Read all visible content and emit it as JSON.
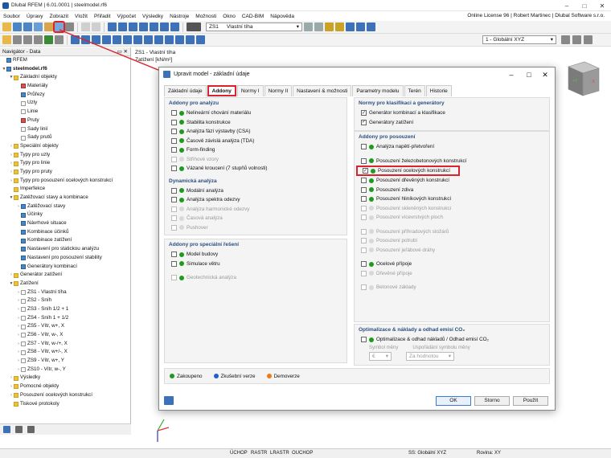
{
  "app": {
    "title": "Dlubal RFEM | 6.01.0001 | steelmodel.rf6"
  },
  "menu": [
    "Soubor",
    "Úpravy",
    "Zobrazit",
    "Vložit",
    "Přiřadit",
    "Výpočet",
    "Výsledky",
    "Nástroje",
    "Možnosti",
    "Okno",
    "CAD-BIM",
    "Nápověda"
  ],
  "license": "Online License 96 | Robert Martinec | Dlubal Software s.r.o.",
  "toolbar": {
    "lc_badge": "G",
    "lc_code": "ZS1",
    "lc_name": "Vlastní tíha",
    "view_combo": "1 - Globální XYZ"
  },
  "navigator": {
    "title": "Navigátor - Data",
    "items": [
      {
        "label": "RFEM",
        "lvl": 0,
        "tw": "",
        "ic": "b"
      },
      {
        "label": "steelmodel.rf6",
        "lvl": 0,
        "tw": "▼",
        "ic": "b",
        "bold": true
      },
      {
        "label": "Základní objekty",
        "lvl": 1,
        "tw": "▼",
        "ic": "y"
      },
      {
        "label": "Materiály",
        "lvl": 2,
        "tw": "",
        "ic": "r"
      },
      {
        "label": "Průřezy",
        "lvl": 2,
        "tw": "",
        "ic": "b"
      },
      {
        "label": "Uzly",
        "lvl": 2,
        "tw": "",
        "ic": ""
      },
      {
        "label": "Linie",
        "lvl": 2,
        "tw": "",
        "ic": ""
      },
      {
        "label": "Pruty",
        "lvl": 2,
        "tw": "",
        "ic": "r"
      },
      {
        "label": "Sady linií",
        "lvl": 2,
        "tw": "",
        "ic": ""
      },
      {
        "label": "Sady prutů",
        "lvl": 2,
        "tw": "",
        "ic": ""
      },
      {
        "label": "Speciální objekty",
        "lvl": 1,
        "tw": "›",
        "ic": "y"
      },
      {
        "label": "Typy pro uzly",
        "lvl": 1,
        "tw": "›",
        "ic": "y"
      },
      {
        "label": "Typy pro linie",
        "lvl": 1,
        "tw": "›",
        "ic": "y"
      },
      {
        "label": "Typy pro pruty",
        "lvl": 1,
        "tw": "›",
        "ic": "y"
      },
      {
        "label": "Typy pro posouzení ocelových konstrukcí",
        "lvl": 1,
        "tw": "›",
        "ic": "y"
      },
      {
        "label": "Imperfekce",
        "lvl": 1,
        "tw": "",
        "ic": "y"
      },
      {
        "label": "Zatěžovací stavy a kombinace",
        "lvl": 1,
        "tw": "▼",
        "ic": "y"
      },
      {
        "label": "Zatěžovací stavy",
        "lvl": 2,
        "tw": "›",
        "ic": "b"
      },
      {
        "label": "Účinky",
        "lvl": 2,
        "tw": "",
        "ic": "b"
      },
      {
        "label": "Návrhové situace",
        "lvl": 2,
        "tw": "",
        "ic": "b"
      },
      {
        "label": "Kombinace účinků",
        "lvl": 2,
        "tw": "",
        "ic": "b"
      },
      {
        "label": "Kombinace zatížení",
        "lvl": 2,
        "tw": "",
        "ic": "b"
      },
      {
        "label": "Nastavení pro statickou analýzu",
        "lvl": 2,
        "tw": "",
        "ic": "b"
      },
      {
        "label": "Nastavení pro posouzení stability",
        "lvl": 2,
        "tw": "",
        "ic": "b"
      },
      {
        "label": "Generátory kombinací",
        "lvl": 2,
        "tw": "",
        "ic": "b"
      },
      {
        "label": "Generátor zatížení",
        "lvl": 1,
        "tw": "›",
        "ic": "y"
      },
      {
        "label": "Zatížení",
        "lvl": 1,
        "tw": "▼",
        "ic": "y"
      },
      {
        "label": "ZS1 - Vlastní tíha",
        "lvl": 2,
        "tw": "›",
        "ic": ""
      },
      {
        "label": "ZS2 - Sníh",
        "lvl": 2,
        "tw": "›",
        "ic": ""
      },
      {
        "label": "ZS3 - Sníh 1/2 + 1",
        "lvl": 2,
        "tw": "›",
        "ic": ""
      },
      {
        "label": "ZS4 - Sníh 1 + 1/2",
        "lvl": 2,
        "tw": "›",
        "ic": ""
      },
      {
        "label": "ZS5 - Vítr, w+, X",
        "lvl": 2,
        "tw": "›",
        "ic": ""
      },
      {
        "label": "ZS6 - Vítr, w-, X",
        "lvl": 2,
        "tw": "›",
        "ic": ""
      },
      {
        "label": "ZS7 - Vítr, w-/+, X",
        "lvl": 2,
        "tw": "›",
        "ic": ""
      },
      {
        "label": "ZS8 - Vítr, w+/-, X",
        "lvl": 2,
        "tw": "›",
        "ic": ""
      },
      {
        "label": "ZS9 - Vítr, w+, Y",
        "lvl": 2,
        "tw": "›",
        "ic": ""
      },
      {
        "label": "ZS10 - Vítr, w-, Y",
        "lvl": 2,
        "tw": "›",
        "ic": ""
      },
      {
        "label": "Výsledky",
        "lvl": 1,
        "tw": "›",
        "ic": "y"
      },
      {
        "label": "Pomocné objekty",
        "lvl": 1,
        "tw": "›",
        "ic": "y"
      },
      {
        "label": "Posouzení ocelových konstrukcí",
        "lvl": 1,
        "tw": "›",
        "ic": "y"
      },
      {
        "label": "Tiskové protokoly",
        "lvl": 1,
        "tw": "",
        "ic": "y"
      }
    ]
  },
  "view": {
    "line1": "ZS1 - Vlastní tíha",
    "line2": "Zatížení [kN/m²]"
  },
  "dialog": {
    "title": "Upravit model - základní údaje",
    "tabs": [
      "Základní údaje",
      "Addony",
      "Normy I",
      "Normy II",
      "Nastavení & možnosti",
      "Parametry modelu",
      "Terén",
      "Historie"
    ],
    "analysis_header": "Addony pro analýzu",
    "analysis": [
      {
        "label": "Nelineární chování materiálu",
        "dot": "g",
        "dis": false
      },
      {
        "label": "Stabilita konstrukce",
        "dot": "g",
        "dis": false
      },
      {
        "label": "Analýza fází výstavby (CSA)",
        "dot": "g",
        "dis": false
      },
      {
        "label": "Časově závislá analýza (TDA)",
        "dot": "g",
        "dis": false
      },
      {
        "label": "Form-finding",
        "dot": "g",
        "dis": false
      },
      {
        "label": "Střihové vzory",
        "dot": "n",
        "dis": true
      },
      {
        "label": "Vázané kroucení (7 stupňů volnosti)",
        "dot": "g",
        "dis": false
      }
    ],
    "dynamic_header": "Dynamická analýza",
    "dynamic": [
      {
        "label": "Modální analýza",
        "dot": "g",
        "dis": false
      },
      {
        "label": "Analýza spektra odezvy",
        "dot": "g",
        "dis": false
      },
      {
        "label": "Analýza harmonické odezvy",
        "dot": "n",
        "dis": true
      },
      {
        "label": "Časová analýza",
        "dot": "n",
        "dis": true
      },
      {
        "label": "Pushover",
        "dot": "n",
        "dis": true
      }
    ],
    "special_header": "Addony pro speciální řešení",
    "special": [
      {
        "label": "Model budovy",
        "dot": "g",
        "dis": false
      },
      {
        "label": "Simulace větru",
        "dot": "g",
        "dis": false
      }
    ],
    "geotech": {
      "label": "Geotechnická analýza",
      "dot": "g",
      "dis": true
    },
    "norms_header": "Normy pro klasifikaci a generátory",
    "norms": [
      {
        "label": "Generátor kombinací a klasifikace",
        "checked": true
      },
      {
        "label": "Generátory zatížení",
        "checked": true
      }
    ],
    "design_header": "Addony pro posouzení",
    "design1": [
      {
        "label": "Analýza napětí-přetvoření",
        "dot": "g",
        "dis": false
      }
    ],
    "design2": [
      {
        "label": "Posouzení železobetonových konstrukcí",
        "dot": "g",
        "dis": false,
        "checked": false
      },
      {
        "label": "Posouzení ocelových konstrukcí",
        "dot": "g",
        "dis": false,
        "checked": true
      },
      {
        "label": "Posouzení dřevěných konstrukcí",
        "dot": "g",
        "dis": false,
        "checked": false
      },
      {
        "label": "Posouzení zdiva",
        "dot": "g",
        "dis": false,
        "checked": false
      },
      {
        "label": "Posouzení hliníkových konstrukcí",
        "dot": "g",
        "dis": false,
        "checked": false
      },
      {
        "label": "Posouzení skleněných konstrukcí",
        "dot": "n",
        "dis": true,
        "checked": false
      },
      {
        "label": "Posouzení vícevrstvých ploch",
        "dot": "n",
        "dis": true,
        "checked": false
      }
    ],
    "design3": [
      {
        "label": "Posouzení příhradových stožárů",
        "dot": "n",
        "dis": true
      },
      {
        "label": "Posouzení potrubí",
        "dot": "n",
        "dis": true
      },
      {
        "label": "Posouzení jeřábové dráhy",
        "dot": "n",
        "dis": true
      }
    ],
    "design4": [
      {
        "label": "Ocelové přípoje",
        "dot": "g",
        "dis": false
      },
      {
        "label": "Dřevěné přípoje",
        "dot": "n",
        "dis": true
      }
    ],
    "design5": [
      {
        "label": "Betonové základy",
        "dot": "n",
        "dis": true
      }
    ],
    "opt_header": "Optimalizace & náklady a odhad emisí CO₂",
    "opt_label": "Optimalizace & odhad nákladů / Odhad emisí CO₂",
    "currency_label": "Symbol měny",
    "currency_value": "€",
    "currency_sym_label": "Uspořádání symbolu měny",
    "currency_sym_value": "Za hodnotou",
    "legend": [
      {
        "label": "Zakoupeno",
        "dot": "g"
      },
      {
        "label": "Zkušební verze",
        "dot": "b"
      },
      {
        "label": "Demoverze",
        "dot": "o"
      }
    ],
    "ok": "OK",
    "cancel": "Storno",
    "apply": "Použít"
  },
  "status": [
    "ÚCHOP",
    "RASTR",
    "LRASTR",
    "OUCHOP",
    "SS: Globální XYZ",
    "Rovina: XY"
  ]
}
